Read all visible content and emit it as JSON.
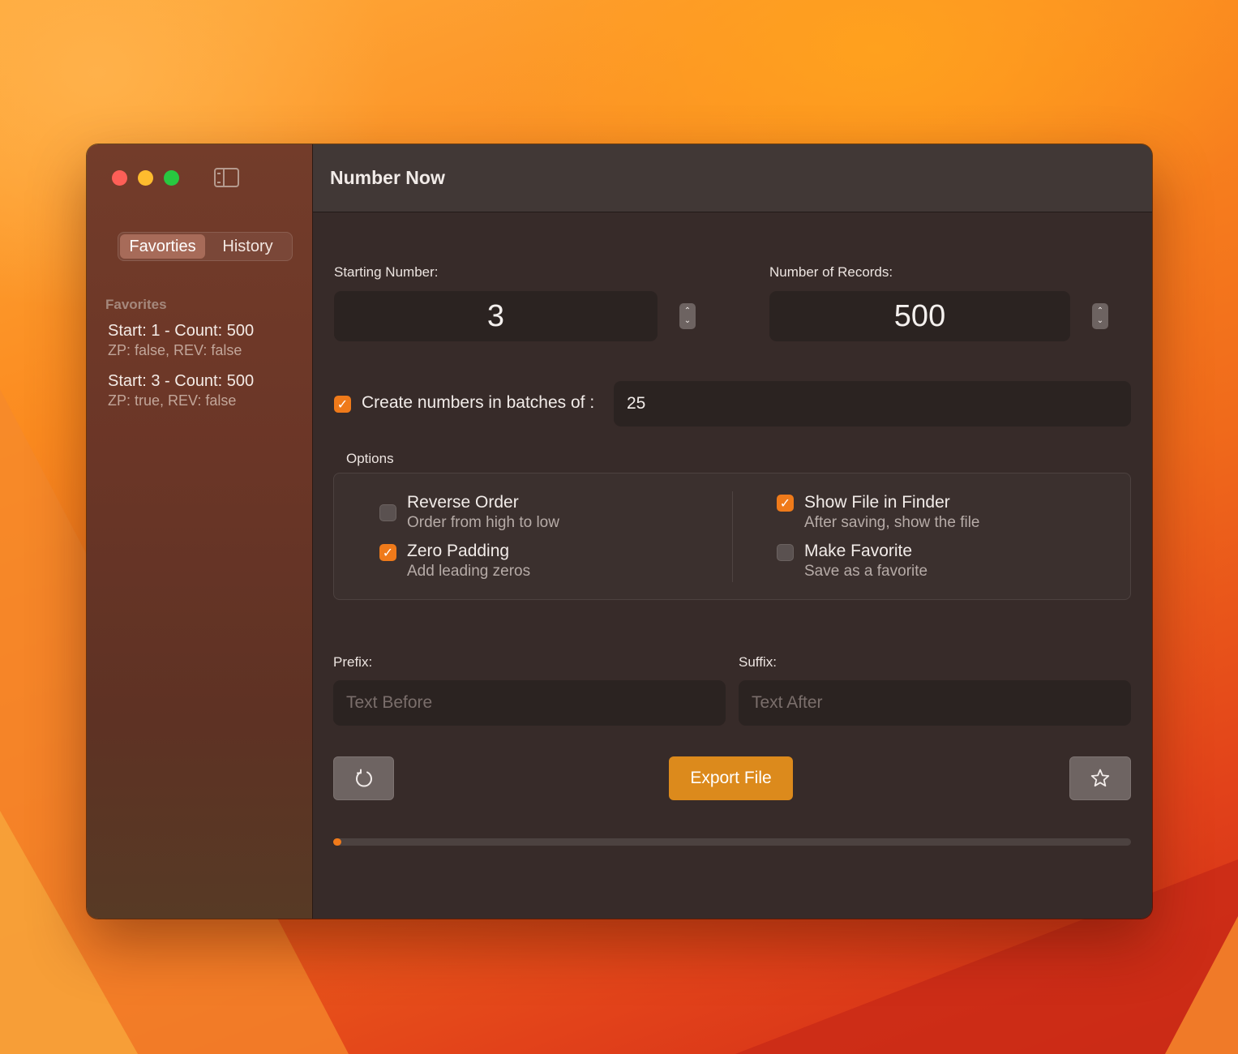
{
  "app": {
    "title": "Number Now"
  },
  "sidebar": {
    "segments": [
      "Favorties",
      "History"
    ],
    "active_segment": "Favorties",
    "section_title": "Favorites",
    "favorites": [
      {
        "title": "Start: 1 - Count: 500",
        "subtitle": "ZP: false, REV: false"
      },
      {
        "title": "Start: 3 - Count: 500",
        "subtitle": "ZP: true, REV: false"
      }
    ]
  },
  "form": {
    "starting_number": {
      "label": "Starting Number:",
      "value": "3"
    },
    "number_of_records": {
      "label": "Number of Records:",
      "value": "500"
    },
    "batches": {
      "checked": true,
      "label": "Create numbers in batches of :",
      "value": "25"
    },
    "options_title": "Options",
    "options": {
      "reverse_order": {
        "checked": false,
        "label": "Reverse Order",
        "description": "Order from high to low"
      },
      "zero_padding": {
        "checked": true,
        "label": "Zero Padding",
        "description": "Add leading zeros"
      },
      "show_in_finder": {
        "checked": true,
        "label": "Show File in Finder",
        "description": "After saving, show the file"
      },
      "make_favorite": {
        "checked": false,
        "label": "Make Favorite",
        "description": "Save as a favorite"
      }
    },
    "prefix": {
      "label": "Prefix:",
      "placeholder": "Text Before"
    },
    "suffix": {
      "label": "Suffix:",
      "placeholder": "Text After"
    }
  },
  "actions": {
    "export_label": "Export File",
    "reset_icon": "reset-icon",
    "favorite_icon": "star-icon"
  },
  "progress": {
    "value": 0.01
  },
  "colors": {
    "accent": "#ef7a1a",
    "export_button": "#dc8a1c",
    "sidebar_bg": "#6b3627",
    "content_bg": "#372b29"
  }
}
